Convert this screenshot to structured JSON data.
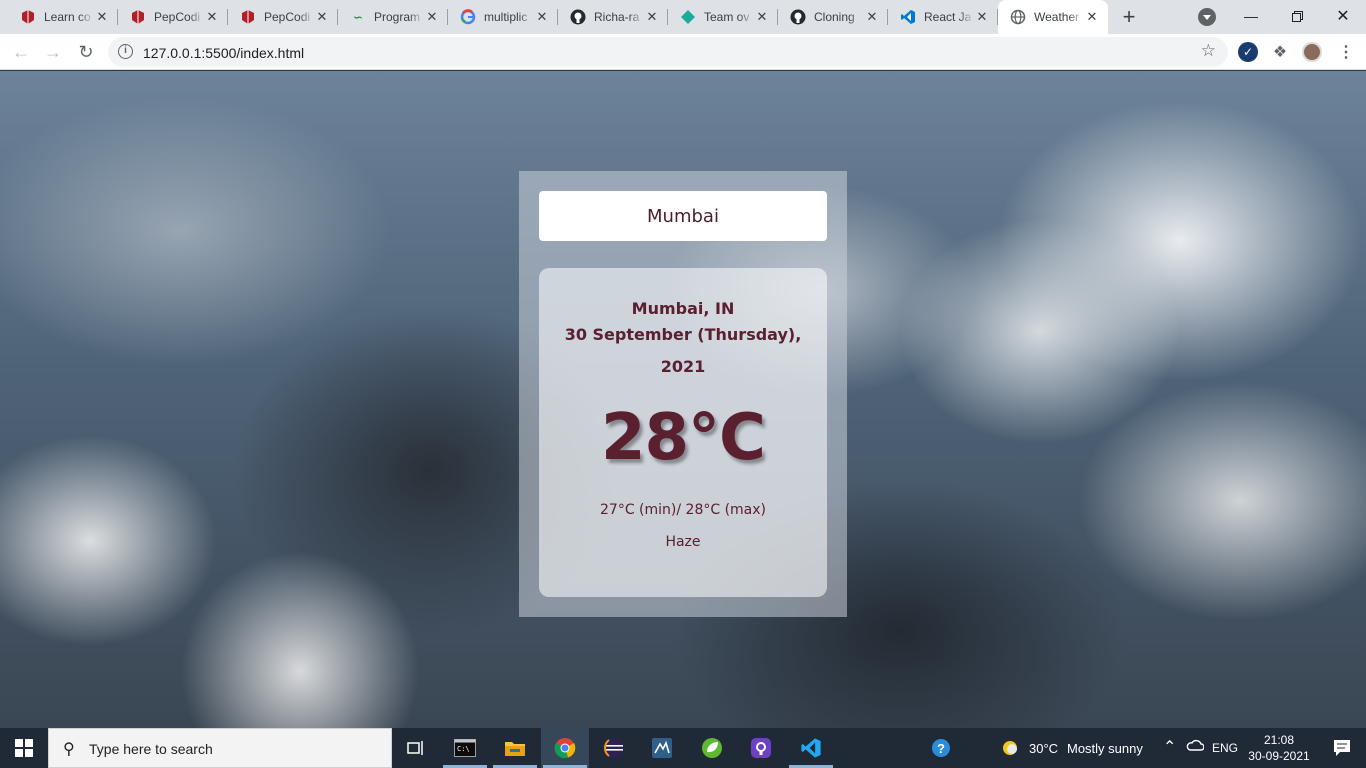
{
  "browser": {
    "tabs": [
      {
        "title": "Learn co",
        "icon": "pepcoding-icon",
        "active": false
      },
      {
        "title": "PepCodi",
        "icon": "pepcoding-icon",
        "active": false
      },
      {
        "title": "PepCodi",
        "icon": "pepcoding-icon",
        "active": false
      },
      {
        "title": "Program",
        "icon": "geeksforgeeks-icon",
        "active": false
      },
      {
        "title": "multiplic",
        "icon": "google-icon",
        "active": false
      },
      {
        "title": "Richa-ra",
        "icon": "github-icon",
        "active": false
      },
      {
        "title": "Team ov",
        "icon": "team-diamond-icon",
        "active": false
      },
      {
        "title": "Cloning",
        "icon": "github-icon",
        "active": false
      },
      {
        "title": "React Ja",
        "icon": "vscode-icon",
        "active": false
      },
      {
        "title": "Weather",
        "icon": "globe-icon",
        "active": true
      }
    ],
    "close_glyph": "✕",
    "new_tab_glyph": "+",
    "url": "127.0.0.1:5500/index.html"
  },
  "weather": {
    "search_value": "Mumbai",
    "location": "Mumbai, IN",
    "date": "30 September (Thursday), 2021",
    "temperature": "28°C",
    "min_max": "27°C (min)/ 28°C (max)",
    "condition": "Haze"
  },
  "taskbar": {
    "search_placeholder": "Type here to search",
    "weather_temp": "30°C",
    "weather_text": "Mostly sunny",
    "language": "ENG",
    "time": "21:08",
    "date": "30-09-2021",
    "accent": "#1f2a36"
  }
}
